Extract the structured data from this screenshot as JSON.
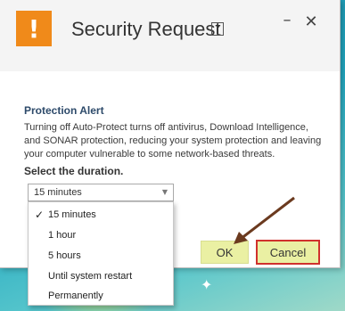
{
  "dialog": {
    "title": "Security Request",
    "alert_icon_glyph": "!",
    "help_icon_glyph": "?",
    "minimize_glyph": "–",
    "close_glyph": "✕"
  },
  "alert": {
    "heading": "Protection Alert",
    "lines": [
      "Turning off Auto-Protect turns off antivirus, Download Intelligence,",
      "and SONAR protection, reducing your system protection and leaving",
      "your computer vulnerable to some network-based threats."
    ]
  },
  "duration": {
    "label": "Select the duration.",
    "selected": "15 minutes",
    "options": [
      {
        "label": "15 minutes",
        "checked": true
      },
      {
        "label": "1 hour",
        "checked": false
      },
      {
        "label": "5 hours",
        "checked": false
      },
      {
        "label": "Until system restart",
        "checked": false
      },
      {
        "label": "Permanently",
        "checked": false
      }
    ],
    "check_glyph": "✓",
    "arrow_glyph": "▼"
  },
  "buttons": {
    "ok": "OK",
    "cancel": "Cancel"
  },
  "colors": {
    "alert_icon": "#f08a1a",
    "button_fill": "#eaf0a3",
    "highlight_border": "#d0312d",
    "annotation_arrow": "#6b3a1f"
  },
  "icons": [
    "exclamation-icon",
    "help-icon",
    "minimize-icon",
    "close-icon",
    "dropdown-arrow-icon",
    "checkmark-icon",
    "annotation-arrow"
  ]
}
